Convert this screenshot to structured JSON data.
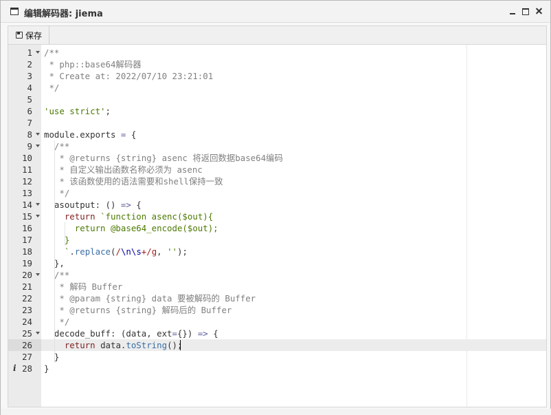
{
  "window": {
    "title": "编辑解码器: jiema",
    "controls": [
      "minimize-icon",
      "maximize-icon",
      "close-icon"
    ]
  },
  "toolbar": {
    "save_icon": "save-icon",
    "save_label": "保存"
  },
  "editor": {
    "active_line": 26,
    "info_line": 28,
    "lines": [
      {
        "n": "1",
        "fold": true,
        "tokens": [
          [
            "c",
            "/**"
          ]
        ]
      },
      {
        "n": "2",
        "fold": false,
        "tokens": [
          [
            "c",
            " * php::base64解码器"
          ]
        ]
      },
      {
        "n": "3",
        "fold": false,
        "tokens": [
          [
            "c",
            " * Create at: 2022/07/10 23:21:01"
          ]
        ]
      },
      {
        "n": "4",
        "fold": false,
        "tokens": [
          [
            "c",
            " */"
          ]
        ]
      },
      {
        "n": "5",
        "fold": false,
        "tokens": []
      },
      {
        "n": "6",
        "fold": false,
        "tokens": [
          [
            "s",
            "'use strict'"
          ],
          [
            "pl",
            ";"
          ]
        ]
      },
      {
        "n": "7",
        "fold": false,
        "tokens": []
      },
      {
        "n": "8",
        "fold": true,
        "tokens": [
          [
            "pl",
            "module.exports "
          ],
          [
            "op",
            "="
          ],
          [
            "pl",
            " {"
          ]
        ]
      },
      {
        "n": "9",
        "fold": true,
        "tokens": [
          [
            "pl",
            "  "
          ],
          [
            "c",
            "/**"
          ]
        ]
      },
      {
        "n": "10",
        "fold": false,
        "tokens": [
          [
            "pl",
            "  "
          ],
          [
            "c",
            " * @returns {string} asenc 将返回数据base64编码"
          ]
        ]
      },
      {
        "n": "11",
        "fold": false,
        "tokens": [
          [
            "pl",
            "  "
          ],
          [
            "c",
            " * 自定义输出函数名称必须为 asenc"
          ]
        ]
      },
      {
        "n": "12",
        "fold": false,
        "tokens": [
          [
            "pl",
            "  "
          ],
          [
            "c",
            " * 该函数使用的语法需要和shell保持一致"
          ]
        ]
      },
      {
        "n": "13",
        "fold": false,
        "tokens": [
          [
            "pl",
            "  "
          ],
          [
            "c",
            " */"
          ]
        ]
      },
      {
        "n": "14",
        "fold": true,
        "tokens": [
          [
            "pl",
            "  asoutput: () "
          ],
          [
            "op",
            "=>"
          ],
          [
            "pl",
            " {"
          ]
        ]
      },
      {
        "n": "15",
        "fold": true,
        "tokens": [
          [
            "pl",
            "    "
          ],
          [
            "kw",
            "return"
          ],
          [
            "pl",
            " "
          ],
          [
            "bt",
            "`function asenc($out){"
          ]
        ]
      },
      {
        "n": "16",
        "fold": false,
        "tokens": [
          [
            "bt",
            "      return @base64_encode($out);"
          ]
        ]
      },
      {
        "n": "17",
        "fold": false,
        "tokens": [
          [
            "bt",
            "    }"
          ]
        ]
      },
      {
        "n": "18",
        "fold": false,
        "tokens": [
          [
            "bt",
            "    `"
          ],
          [
            "pl",
            "."
          ],
          [
            "fn",
            "replace"
          ],
          [
            "pl",
            "("
          ],
          [
            "re",
            "/"
          ],
          [
            "k",
            "\\n\\s"
          ],
          [
            "re",
            "+/g"
          ],
          [
            "pl",
            ", "
          ],
          [
            "s",
            "''"
          ],
          [
            "pl",
            ");"
          ]
        ]
      },
      {
        "n": "19",
        "fold": false,
        "tokens": [
          [
            "pl",
            "  },"
          ]
        ]
      },
      {
        "n": "20",
        "fold": true,
        "tokens": [
          [
            "pl",
            "  "
          ],
          [
            "c",
            "/**"
          ]
        ]
      },
      {
        "n": "21",
        "fold": false,
        "tokens": [
          [
            "pl",
            "  "
          ],
          [
            "c",
            " * 解码 Buffer"
          ]
        ]
      },
      {
        "n": "22",
        "fold": false,
        "tokens": [
          [
            "pl",
            "  "
          ],
          [
            "c",
            " * @param {string} data 要被解码的 Buffer"
          ]
        ]
      },
      {
        "n": "23",
        "fold": false,
        "tokens": [
          [
            "pl",
            "  "
          ],
          [
            "c",
            " * @returns {string} 解码后的 Buffer"
          ]
        ]
      },
      {
        "n": "24",
        "fold": false,
        "tokens": [
          [
            "pl",
            "  "
          ],
          [
            "c",
            " */"
          ]
        ]
      },
      {
        "n": "25",
        "fold": true,
        "tokens": [
          [
            "pl",
            "  decode_buff: (data, ext"
          ],
          [
            "op",
            "="
          ],
          [
            "pl",
            "{}) "
          ],
          [
            "op",
            "=>"
          ],
          [
            "pl",
            " {"
          ]
        ]
      },
      {
        "n": "26",
        "fold": false,
        "tokens": [
          [
            "pl",
            "    "
          ],
          [
            "kw",
            "return"
          ],
          [
            "pl",
            " data."
          ],
          [
            "fn",
            "toString"
          ],
          [
            "pl",
            "();"
          ]
        ]
      },
      {
        "n": "27",
        "fold": false,
        "tokens": [
          [
            "pl",
            "  }"
          ]
        ]
      },
      {
        "n": "28",
        "fold": false,
        "tokens": [
          [
            "pl",
            "}"
          ]
        ]
      }
    ]
  }
}
